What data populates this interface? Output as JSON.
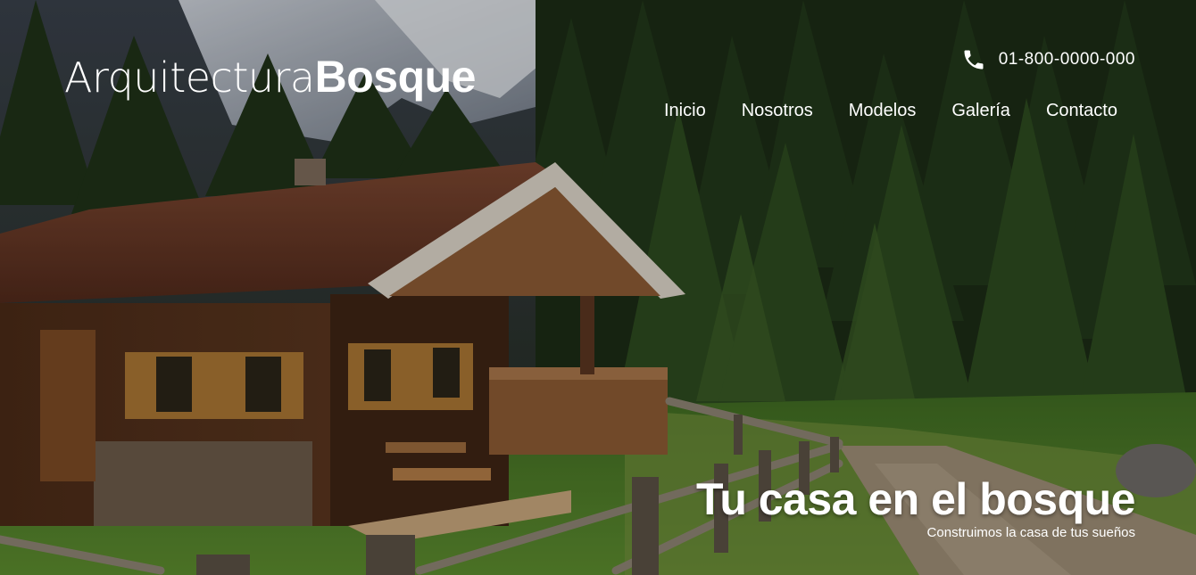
{
  "header": {
    "logo_light": "Arquitectura",
    "logo_bold": "Bosque",
    "phone_icon": "phone-icon",
    "phone_number": "01-800-0000-000"
  },
  "nav": {
    "items": [
      {
        "label": "Inicio"
      },
      {
        "label": "Nosotros"
      },
      {
        "label": "Modelos"
      },
      {
        "label": "Galería"
      },
      {
        "label": "Contacto"
      }
    ]
  },
  "hero": {
    "headline": "Tu casa en el bosque",
    "subline": "Construimos la casa de tus sueños"
  },
  "colors": {
    "text": "#ffffff",
    "forest_dark": "#1f2a16",
    "grass": "#4f7a2a",
    "roof": "#6b3a26",
    "wood": "#5a3520"
  }
}
